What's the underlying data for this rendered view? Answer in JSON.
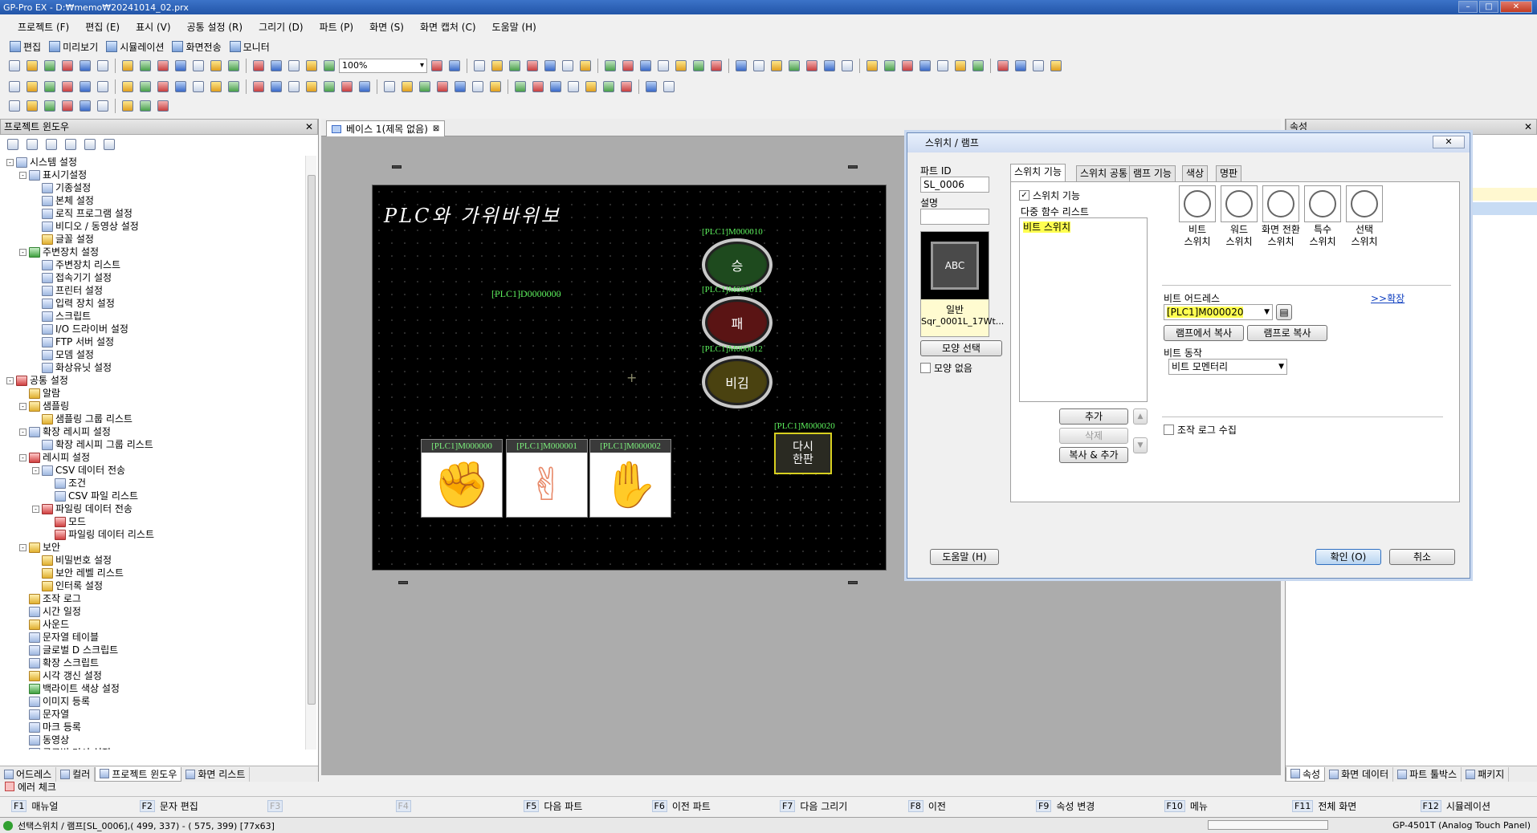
{
  "window": {
    "title": "GP-Pro EX - D:₩memo₩20241014_02.prx"
  },
  "menu": [
    "프로젝트 (F)",
    "편집 (E)",
    "표시 (V)",
    "공통 설정 (R)",
    "그리기 (D)",
    "파트 (P)",
    "화면 (S)",
    "화면 캡처 (C)",
    "도움말 (H)"
  ],
  "modes": [
    "편집",
    "미리보기",
    "시뮬레이션",
    "화면전송",
    "모니터"
  ],
  "toolbar": {
    "zoom": "100%"
  },
  "project_window": {
    "title": "프로젝트 윈도우",
    "tree": [
      {
        "label": "시스템 설정",
        "level": 0,
        "exp": "-",
        "icon": "b"
      },
      {
        "label": "표시기설정",
        "level": 1,
        "exp": "-",
        "icon": "b"
      },
      {
        "label": "기종설정",
        "level": 2,
        "icon": "b"
      },
      {
        "label": "본체 설정",
        "level": 2,
        "icon": "b"
      },
      {
        "label": "로직 프로그램 설정",
        "level": 2,
        "icon": "b"
      },
      {
        "label": "비디오 / 동영상 설정",
        "level": 2,
        "icon": "b"
      },
      {
        "label": "글꼴 설정",
        "level": 2,
        "icon": "y"
      },
      {
        "label": "주변장치 설정",
        "level": 1,
        "exp": "-",
        "icon": "g"
      },
      {
        "label": "주변장치 리스트",
        "level": 2,
        "icon": "b"
      },
      {
        "label": "접속기기 설정",
        "level": 2,
        "icon": "b"
      },
      {
        "label": "프린터 설정",
        "level": 2,
        "icon": "b"
      },
      {
        "label": "입력 장치 설정",
        "level": 2,
        "icon": "b"
      },
      {
        "label": "스크립트",
        "level": 2,
        "icon": "b"
      },
      {
        "label": "I/O 드라이버 설정",
        "level": 2,
        "icon": "b"
      },
      {
        "label": "FTP 서버 설정",
        "level": 2,
        "icon": "b"
      },
      {
        "label": "모뎀 설정",
        "level": 2,
        "icon": "b"
      },
      {
        "label": "화상유닛 설정",
        "level": 2,
        "icon": "b"
      },
      {
        "label": "공통 설정",
        "level": 0,
        "exp": "-",
        "icon": "r"
      },
      {
        "label": "알람",
        "level": 1,
        "icon": "y"
      },
      {
        "label": "샘플링",
        "level": 1,
        "exp": "-",
        "icon": "y"
      },
      {
        "label": "샘플링 그룹 리스트",
        "level": 2,
        "icon": "y"
      },
      {
        "label": "확장 레시피 설정",
        "level": 1,
        "exp": "-",
        "icon": "b"
      },
      {
        "label": "확장 레시피 그룹 리스트",
        "level": 2,
        "icon": "b"
      },
      {
        "label": "레시피 설정",
        "level": 1,
        "exp": "-",
        "icon": "r"
      },
      {
        "label": "CSV 데이터 전송",
        "level": 2,
        "exp": "-",
        "icon": "b"
      },
      {
        "label": "조건",
        "level": 3,
        "icon": "b"
      },
      {
        "label": "CSV 파일 리스트",
        "level": 3,
        "icon": "b"
      },
      {
        "label": "파일링 데이터 전송",
        "level": 2,
        "exp": "-",
        "icon": "r"
      },
      {
        "label": "모드",
        "level": 3,
        "icon": "r"
      },
      {
        "label": "파일링 데이터 리스트",
        "level": 3,
        "icon": "r"
      },
      {
        "label": "보안",
        "level": 1,
        "exp": "-",
        "icon": "y"
      },
      {
        "label": "비밀번호 설정",
        "level": 2,
        "icon": "y"
      },
      {
        "label": "보안 레벨 리스트",
        "level": 2,
        "icon": "y"
      },
      {
        "label": "인터록 설정",
        "level": 2,
        "icon": "y"
      },
      {
        "label": "조작 로그",
        "level": 1,
        "icon": "y"
      },
      {
        "label": "시간 일정",
        "level": 1,
        "icon": "b"
      },
      {
        "label": "사운드",
        "level": 1,
        "icon": "y"
      },
      {
        "label": "문자열 테이블",
        "level": 1,
        "icon": "b"
      },
      {
        "label": "글로벌 D 스크립트",
        "level": 1,
        "icon": "b"
      },
      {
        "label": "확장 스크립트",
        "level": 1,
        "icon": "b"
      },
      {
        "label": "시각 갱신 설정",
        "level": 1,
        "icon": "y"
      },
      {
        "label": "백라이트 색상 설정",
        "level": 1,
        "icon": "g"
      },
      {
        "label": "이미지 등록",
        "level": 1,
        "icon": "b"
      },
      {
        "label": "문자열",
        "level": 1,
        "icon": "b"
      },
      {
        "label": "마크 등록",
        "level": 1,
        "icon": "b"
      },
      {
        "label": "동영상",
        "level": 1,
        "icon": "b"
      },
      {
        "label": "글로벌 커서 설정",
        "level": 1,
        "icon": "b"
      }
    ],
    "tabs": [
      "어드레스",
      "컬러",
      "프로젝트 윈도우",
      "화면 리스트"
    ]
  },
  "editor": {
    "tab": "베이스 1(제목 없음)",
    "canvas_title": "PLC와 가위바위보",
    "data_label": "[PLC1]D0000000",
    "lamps": [
      {
        "addr": "[PLC1]M000010",
        "text": "승",
        "color": "#1e4a1e"
      },
      {
        "addr": "[PLC1]M000011",
        "text": "패",
        "color": "#5a1414"
      },
      {
        "addr": "[PLC1]M000012",
        "text": "비김",
        "color": "#4a4210"
      }
    ],
    "reset": {
      "addr": "[PLC1]M000020",
      "text": "다시\n한판"
    },
    "hands": [
      {
        "addr": "[PLC1]M000000",
        "emoji": "✊"
      },
      {
        "addr": "[PLC1]M000001",
        "emoji": "✌"
      },
      {
        "addr": "[PLC1]M000002",
        "emoji": "✋"
      }
    ]
  },
  "dialog": {
    "title": "스위치 / 램프",
    "part_id_label": "파트 ID",
    "part_id": "SL_0006",
    "desc_label": "설명",
    "preview_text": "ABC",
    "preview_caption1": "일반",
    "preview_caption2": "Sqr_0001L_17Wt...",
    "shape_btn": "모양 선택",
    "no_shape": "모양 없음",
    "tabs": [
      "스위치 기능",
      "스위치 공통",
      "램프 기능",
      "색상",
      "명판"
    ],
    "switch_func": "스위치 기능",
    "multi_list": "다중 함수 리스트",
    "list_item": "비트 스위치",
    "add": "추가",
    "delete": "삭제",
    "copy_add": "복사 & 추가",
    "icons": [
      "비트\n스위치",
      "워드\n스위치",
      "화면 전환\n스위치",
      "특수\n스위치",
      "선택\n스위치"
    ],
    "bit_addr_label": "비트 어드레스",
    "expand": ">>확장",
    "bit_addr": "[PLC1]M000020",
    "copy_from_lamp": "램프에서 복사",
    "copy_to_lamp": "램프로 복사",
    "bit_action_label": "비트 동작",
    "bit_action": "비트 모멘터리",
    "oplog": "조작 로그 수집",
    "help": "도움말 (H)",
    "ok": "확인 (O)",
    "cancel": "취소"
  },
  "right_panel": {
    "title": "속성",
    "tabs": [
      "속성",
      "화면 데이터",
      "파트 툴박스",
      "패키지"
    ]
  },
  "error_tab": "에러 체크",
  "fkeys": [
    {
      "k": "F1",
      "t": "매뉴얼"
    },
    {
      "k": "F2",
      "t": "문자 편집"
    },
    {
      "k": "F3",
      "t": ""
    },
    {
      "k": "F4",
      "t": ""
    },
    {
      "k": "F5",
      "t": "다음 파트"
    },
    {
      "k": "F6",
      "t": "이전 파트"
    },
    {
      "k": "F7",
      "t": "다음 그리기"
    },
    {
      "k": "F8",
      "t": "이전"
    },
    {
      "k": "F9",
      "t": "속성 변경"
    },
    {
      "k": "F10",
      "t": "메뉴"
    },
    {
      "k": "F11",
      "t": "전체 화면"
    },
    {
      "k": "F12",
      "t": "시뮬레이션"
    }
  ],
  "status": {
    "left": "선택스위치 / 램프[SL_0006],( 499, 337) - ( 575, 399) [77x63]",
    "model": "GP-4501T (Analog Touch Panel)"
  }
}
